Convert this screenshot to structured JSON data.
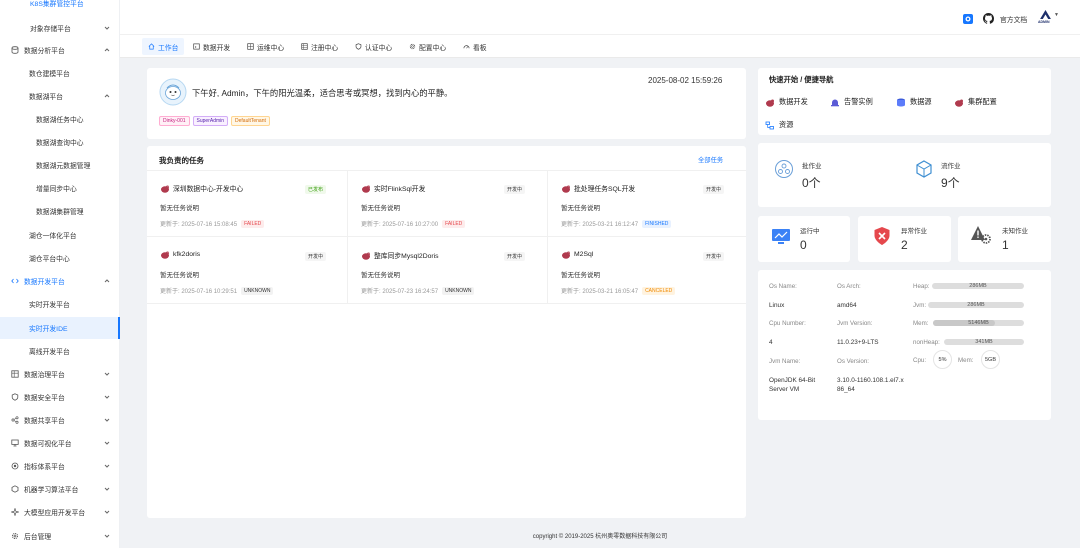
{
  "sidebar": {
    "items": [
      {
        "label": "K8S集群管控平台"
      },
      {
        "label": "对象存储平台"
      },
      {
        "label": "数据分析平台"
      },
      {
        "label": "数仓建模平台"
      },
      {
        "label": "数据湖平台"
      },
      {
        "label": "数据湖任务中心"
      },
      {
        "label": "数据湖查询中心"
      },
      {
        "label": "数据湖元数据管理"
      },
      {
        "label": "增量同步中心"
      },
      {
        "label": "数据湖集群管理"
      },
      {
        "label": "湖仓一体化平台"
      },
      {
        "label": "湖仓平台中心"
      },
      {
        "label": "数据开发平台"
      },
      {
        "label": "实时开发平台"
      },
      {
        "label": "实时开发IDE"
      },
      {
        "label": "离线开发平台"
      },
      {
        "label": "数据治理平台"
      },
      {
        "label": "数据安全平台"
      },
      {
        "label": "数据共享平台"
      },
      {
        "label": "数据可视化平台"
      },
      {
        "label": "指标体系平台"
      },
      {
        "label": "机器学习算法平台"
      },
      {
        "label": "大模型应用开发平台"
      },
      {
        "label": "后台管理"
      }
    ]
  },
  "header": {
    "docs_label": "官方文档",
    "avatar_label": "ADMIN"
  },
  "tabs": [
    {
      "label": "工作台"
    },
    {
      "label": "数据开发"
    },
    {
      "label": "运维中心"
    },
    {
      "label": "注册中心"
    },
    {
      "label": "认证中心"
    },
    {
      "label": "配置中心"
    },
    {
      "label": "看板"
    }
  ],
  "welcome": {
    "greeting": "下午好, Admin，下午的阳光温柔，适合思考或冥想，找到内心的平静。",
    "datetime": "2025-08-02 15:59:26",
    "tags": [
      "Dinky-001",
      "SuperAdmin",
      "DefaultTenant"
    ]
  },
  "tasks": {
    "title": "我负责的任务",
    "all_link": "全部任务",
    "items": [
      {
        "name": "深圳数据中心-开发中心",
        "badge": "已发布",
        "desc": "暂无任务说明",
        "updated": "更新于: 2025-07-16 15:08:45",
        "status": "FAILED"
      },
      {
        "name": "实时FlinkSql开发",
        "badge": "开发中",
        "desc": "暂无任务说明",
        "updated": "更新于: 2025-07-16 10:27:00",
        "status": "FAILED"
      },
      {
        "name": "批处理任务SQL开发",
        "badge": "开发中",
        "desc": "暂无任务说明",
        "updated": "更新于: 2025-03-21 16:12:47",
        "status": "FINISHED"
      },
      {
        "name": "kfk2doris",
        "badge": "开发中",
        "desc": "暂无任务说明",
        "updated": "更新于: 2025-07-16 10:29:51",
        "status": "UNKNOWN"
      },
      {
        "name": "整库同步Mysql2Doris",
        "badge": "开发中",
        "desc": "暂无任务说明",
        "updated": "更新于: 2025-07-23 16:24:57",
        "status": "UNKNOWN"
      },
      {
        "name": "M2Sql",
        "badge": "开发中",
        "desc": "暂无任务说明",
        "updated": "更新于: 2025-03-21 16:05:47",
        "status": "CANCELED"
      }
    ]
  },
  "quick_nav": {
    "title": "快速开始 / 便捷导航",
    "items": [
      {
        "label": "数据开发"
      },
      {
        "label": "告警实例"
      },
      {
        "label": "数据源"
      },
      {
        "label": "集群配置"
      },
      {
        "label": "资源"
      }
    ]
  },
  "job_stats": {
    "batch_label": "批作业",
    "batch_value": "0个",
    "stream_label": "流作业",
    "stream_value": "9个"
  },
  "run_stats": {
    "running_label": "运行中",
    "running_value": "0",
    "error_label": "异常作业",
    "error_value": "2",
    "unknown_label": "未知作业",
    "unknown_value": "1"
  },
  "system": {
    "os_name_label": "Os Name:",
    "os_name": "Linux",
    "os_arch_label": "Os Arch:",
    "os_arch": "amd64",
    "cpu_number_label": "Cpu Number:",
    "cpu_number": "4",
    "jvm_version_label": "Jvm Version:",
    "jvm_version": "11.0.23+9-LTS",
    "jvm_name_label": "Jvm Name:",
    "jvm_name": "OpenJDK 64-Bit Server VM",
    "os_version_label": "Os Version:",
    "os_version": "3.10.0-1160.108.1.el7.x86_64",
    "heap_label": "Heap:",
    "heap": "286MB",
    "jvm_label": "Jvm:",
    "jvm": "286MB",
    "mem_label": "Mem:",
    "mem": "5146MB",
    "nonheap_label": "nonHeap:",
    "nonheap": "341MB",
    "cpu_label": "Cpu:",
    "cpu": "5%",
    "mem2_label": "Mem:",
    "mem2": "5GB"
  },
  "footer": {
    "text": "copyright © 2019-2025 杭州奥零数据科技有限公司"
  },
  "colors": {
    "accent": "#1677ff",
    "danger": "#e5484d",
    "bg": "#f0f2f5"
  }
}
